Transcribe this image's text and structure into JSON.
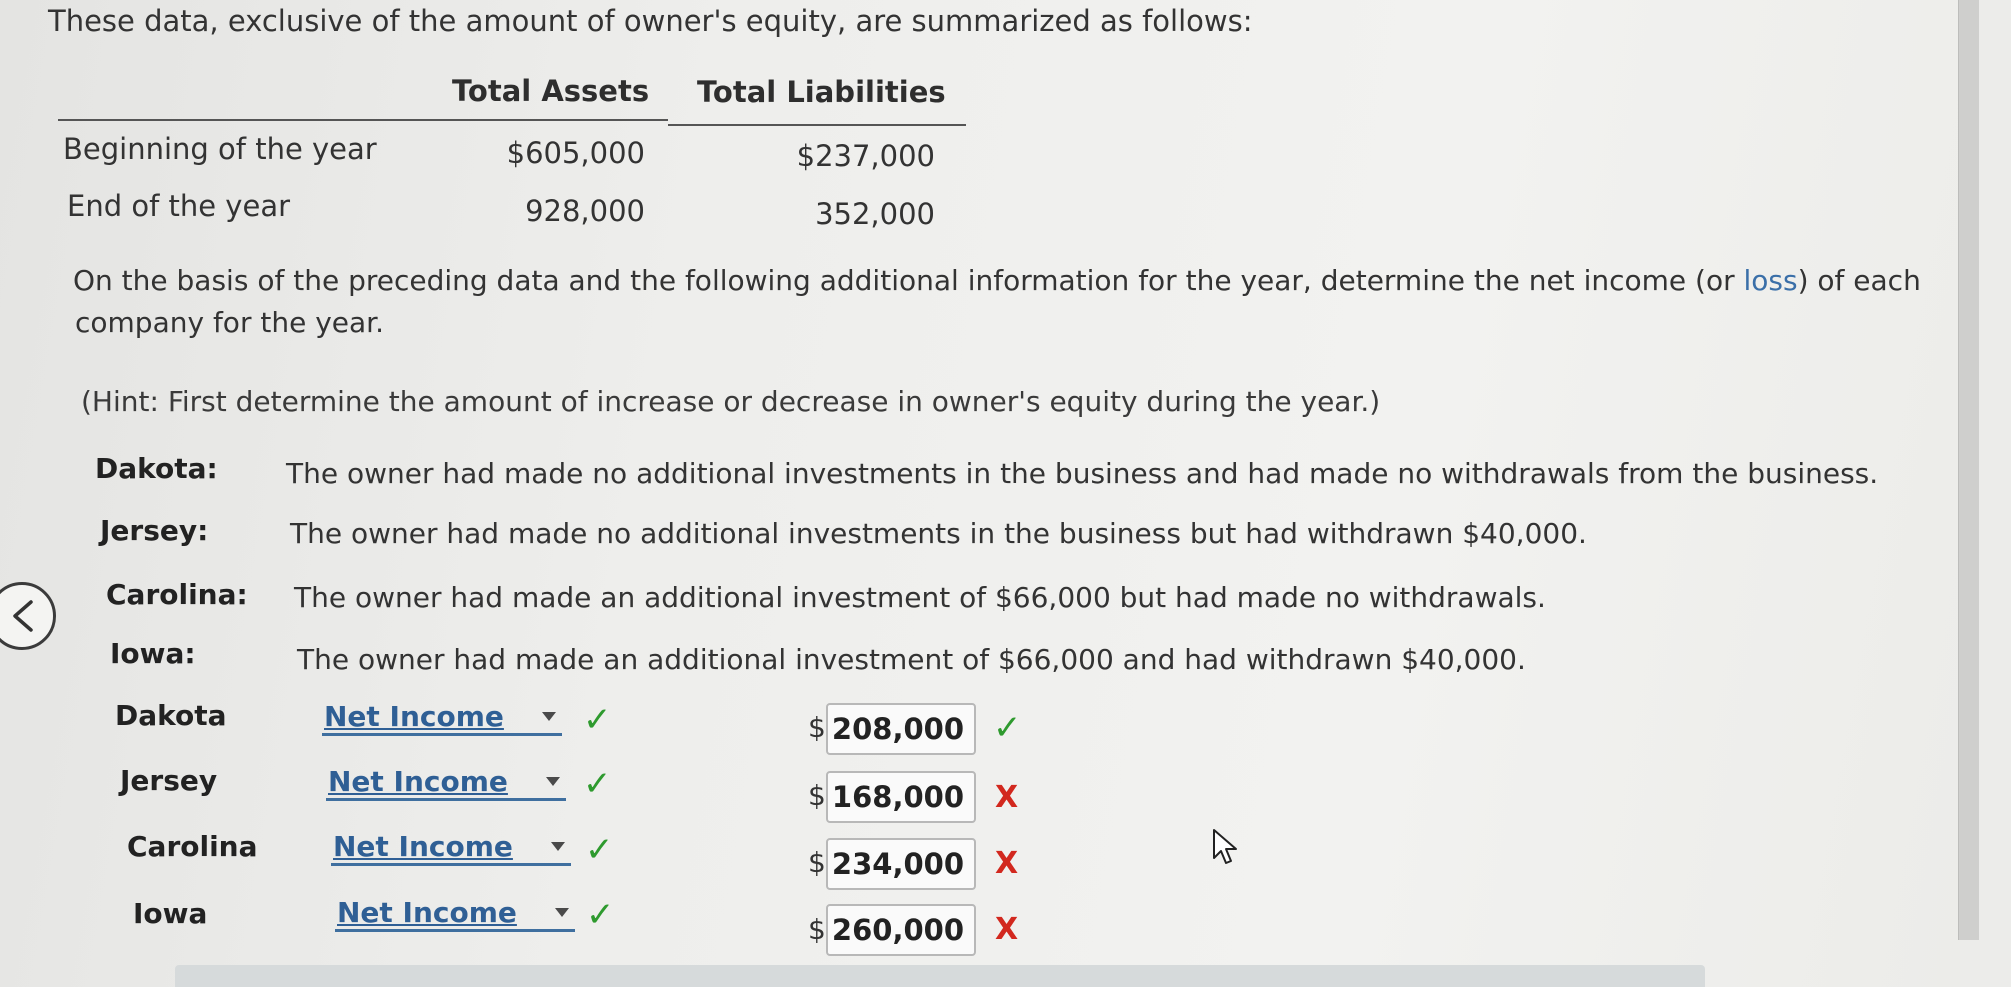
{
  "intro": "These data, exclusive of the amount of owner's equity, are summarized as follows:",
  "table": {
    "headers": [
      "Total Assets",
      "Total Liabilities"
    ],
    "rows": [
      {
        "label": "Beginning of the year",
        "assets": "$605,000",
        "liabilities": "$237,000"
      },
      {
        "label": "End of the year",
        "assets": "928,000",
        "liabilities": "352,000"
      }
    ]
  },
  "instructions": {
    "part1": "On the basis of the preceding data and the following additional information for the year, determine the net income (or ",
    "loss_word": "loss",
    "part2": ") of each",
    "line2": "company for the year."
  },
  "hint": "(Hint: First determine the amount of increase or decrease in owner's equity during the year.)",
  "companies": [
    {
      "label": "Dakota:",
      "desc": "The owner had made no additional investments in the business and had made no withdrawals from the business."
    },
    {
      "label": "Jersey:",
      "desc": "The owner had made no additional investments in the business but had withdrawn $40,000."
    },
    {
      "label": "Carolina:",
      "desc": "The owner had made an additional investment of $66,000 but had made no withdrawals."
    },
    {
      "label": "Iowa:",
      "desc": "The owner had made an additional investment of $66,000 and had withdrawn $40,000."
    }
  ],
  "answers": [
    {
      "company": "Dakota",
      "select_value": "Net Income",
      "select_mark": "✓",
      "currency": "$",
      "amount": "208,000",
      "amount_mark": "✓",
      "amount_correct": true
    },
    {
      "company": "Jersey",
      "select_value": "Net Income",
      "select_mark": "✓",
      "currency": "$",
      "amount": "168,000",
      "amount_mark": "X",
      "amount_correct": false
    },
    {
      "company": "Carolina",
      "select_value": "Net Income",
      "select_mark": "✓",
      "currency": "$",
      "amount": "234,000",
      "amount_mark": "X",
      "amount_correct": false
    },
    {
      "company": "Iowa",
      "select_value": "Net Income",
      "select_mark": "✓",
      "currency": "$",
      "amount": "260,000",
      "amount_mark": "X",
      "amount_correct": false
    }
  ],
  "colors": {
    "correct": "#2e9a2e",
    "incorrect": "#d2281e",
    "link": "#2f5f95"
  },
  "icons": {
    "back": "chevron-left-icon",
    "cursor": "mouse-pointer-icon"
  }
}
